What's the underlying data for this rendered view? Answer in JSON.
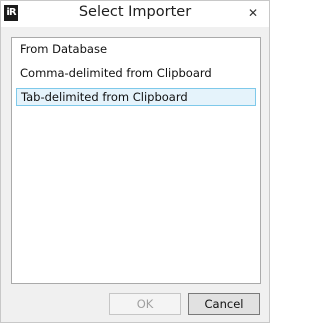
{
  "window": {
    "title": "Select Importer",
    "app_icon_text": "iR",
    "close_glyph": "✕"
  },
  "importers": {
    "items": [
      {
        "label": "From Database",
        "selected": false
      },
      {
        "label": "Comma-delimited from Clipboard",
        "selected": false
      },
      {
        "label": "Tab-delimited from Clipboard",
        "selected": true
      }
    ]
  },
  "buttons": {
    "ok_label": "OK",
    "ok_enabled": false,
    "cancel_label": "Cancel"
  },
  "colors": {
    "selection_fill": "#e5f3fb",
    "selection_border": "#7ec9ea",
    "dialog_background": "#f0f0f0"
  }
}
